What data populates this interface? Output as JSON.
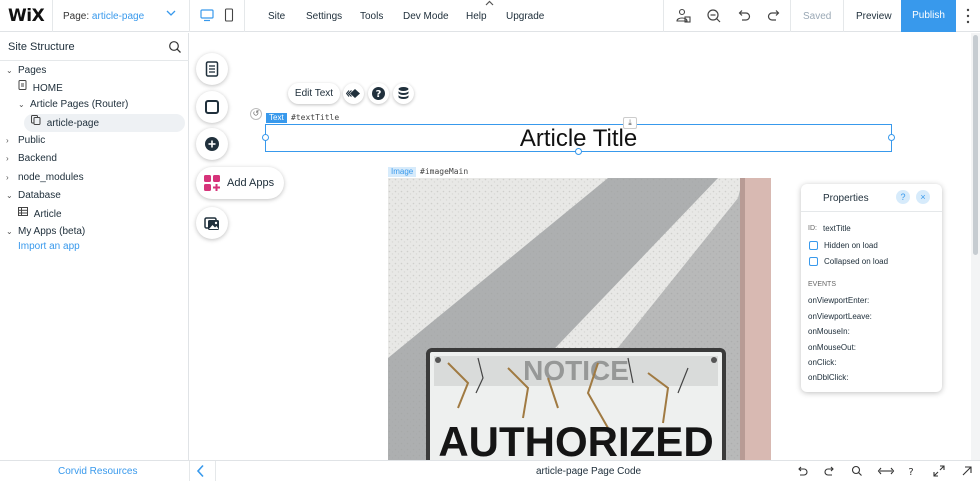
{
  "topbar": {
    "logo": "WiX",
    "page_label": "Page:",
    "page_value": "article-page",
    "menu": [
      "Site",
      "Settings",
      "Tools",
      "Dev Mode",
      "Help",
      "Upgrade"
    ],
    "saved": "Saved",
    "preview": "Preview",
    "publish": "Publish",
    "accent": "#3899ec"
  },
  "sidebar": {
    "title": "Site Structure",
    "items": [
      {
        "label": "Pages",
        "icon": "chevron-down-icon"
      },
      {
        "label": "HOME",
        "icon": "page-icon"
      },
      {
        "label": "Article Pages (Router)",
        "icon": "chevron-down-icon"
      },
      {
        "label": "article-page",
        "icon": "dynamic-page-icon"
      },
      {
        "label": "Public",
        "icon": "chevron-right-icon"
      },
      {
        "label": "Backend",
        "icon": "chevron-right-icon"
      },
      {
        "label": "node_modules",
        "icon": "chevron-right-icon"
      },
      {
        "label": "Database",
        "icon": "chevron-down-icon"
      },
      {
        "label": "Article",
        "icon": "table-icon"
      },
      {
        "label": "My Apps (beta)",
        "icon": "chevron-down-icon"
      },
      {
        "label": "Import an app",
        "icon": ""
      }
    ]
  },
  "canvas": {
    "add_apps": "Add Apps",
    "edit_text": "Edit Text",
    "text_tag": "Text",
    "text_id": "#textTitle",
    "title": "Article Title",
    "image_tag": "Image",
    "image_id": "#imageMain",
    "sign_text": "AUTHORIZED"
  },
  "properties": {
    "title": "Properties",
    "help": "?",
    "close": "×",
    "id_label": "ID:",
    "id_value": "textTitle",
    "checks": [
      "Hidden on load",
      "Collapsed on load"
    ],
    "events_heading": "EVENTS",
    "events": [
      "onViewportEnter:",
      "onViewportLeave:",
      "onMouseIn:",
      "onMouseOut:",
      "onClick:",
      "onDblClick:"
    ]
  },
  "bottombar": {
    "corvid_resources": "Corvid Resources",
    "page_code": "article-page Page Code",
    "collapse": "‹"
  }
}
